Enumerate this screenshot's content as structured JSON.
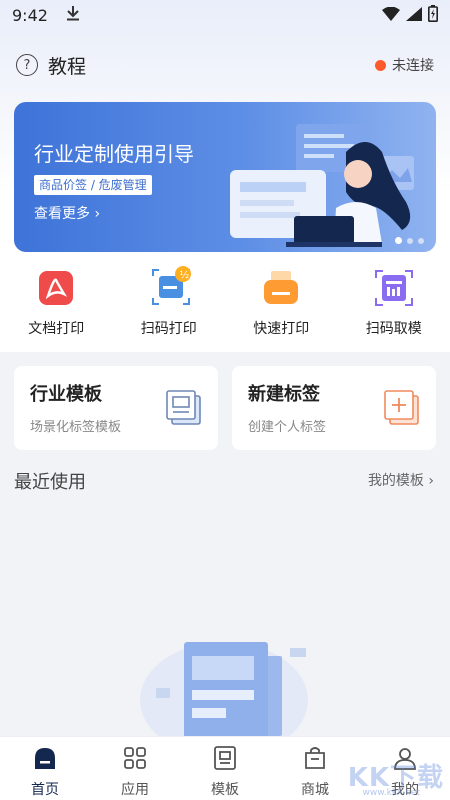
{
  "status_bar": {
    "time": "9:42"
  },
  "header": {
    "title": "教程",
    "connection_status": "未连接"
  },
  "banner": {
    "title": "行业定制使用引导",
    "tag": "商品价签 / 危废管理",
    "more": "查看更多",
    "page_count": 3,
    "active_page": 1
  },
  "quick_actions": [
    {
      "label": "文档打印",
      "icon": "pdf-document-icon",
      "color": "#f04b4b"
    },
    {
      "label": "扫码打印",
      "icon": "scan-print-icon",
      "color": "#4a90e2"
    },
    {
      "label": "快速打印",
      "icon": "printer-icon",
      "color": "#ff9b33"
    },
    {
      "label": "扫码取模",
      "icon": "scan-template-icon",
      "color": "#8a6cf0"
    }
  ],
  "cards": [
    {
      "title": "行业模板",
      "subtitle": "场景化标签模板",
      "icon": "template-stack-icon"
    },
    {
      "title": "新建标签",
      "subtitle": "创建个人标签",
      "icon": "add-label-icon"
    }
  ],
  "recent": {
    "title": "最近使用",
    "link": "我的模板"
  },
  "bottom_nav": [
    {
      "label": "首页",
      "icon": "home-icon",
      "active": true
    },
    {
      "label": "应用",
      "icon": "apps-grid-icon",
      "active": false
    },
    {
      "label": "模板",
      "icon": "template-icon",
      "active": false
    },
    {
      "label": "商城",
      "icon": "shop-icon",
      "active": false
    },
    {
      "label": "我的",
      "icon": "profile-icon",
      "active": false
    }
  ],
  "watermark": {
    "logo": "KK下载",
    "url": "www.kkx.net"
  },
  "colors": {
    "accent": "#3e73d8",
    "nav_active": "#14274e",
    "status_dot": "#ff5a2b"
  }
}
